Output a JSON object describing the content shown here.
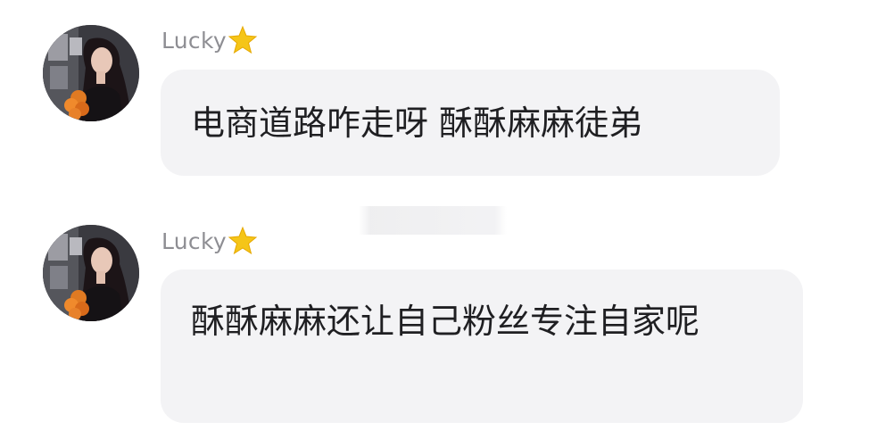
{
  "messages": [
    {
      "sender": "Lucky",
      "badge_icon": "star-icon",
      "text": "电商道路咋走呀 酥酥麻麻徒弟"
    },
    {
      "sender": "Lucky",
      "badge_icon": "star-icon",
      "text": "酥酥麻麻还让自己粉丝专注自家呢"
    }
  ],
  "colors": {
    "bubble_background": "#f3f3f5",
    "sender_name": "#8e8e93",
    "message_text": "#1f1f22",
    "star": "#f5c518"
  }
}
